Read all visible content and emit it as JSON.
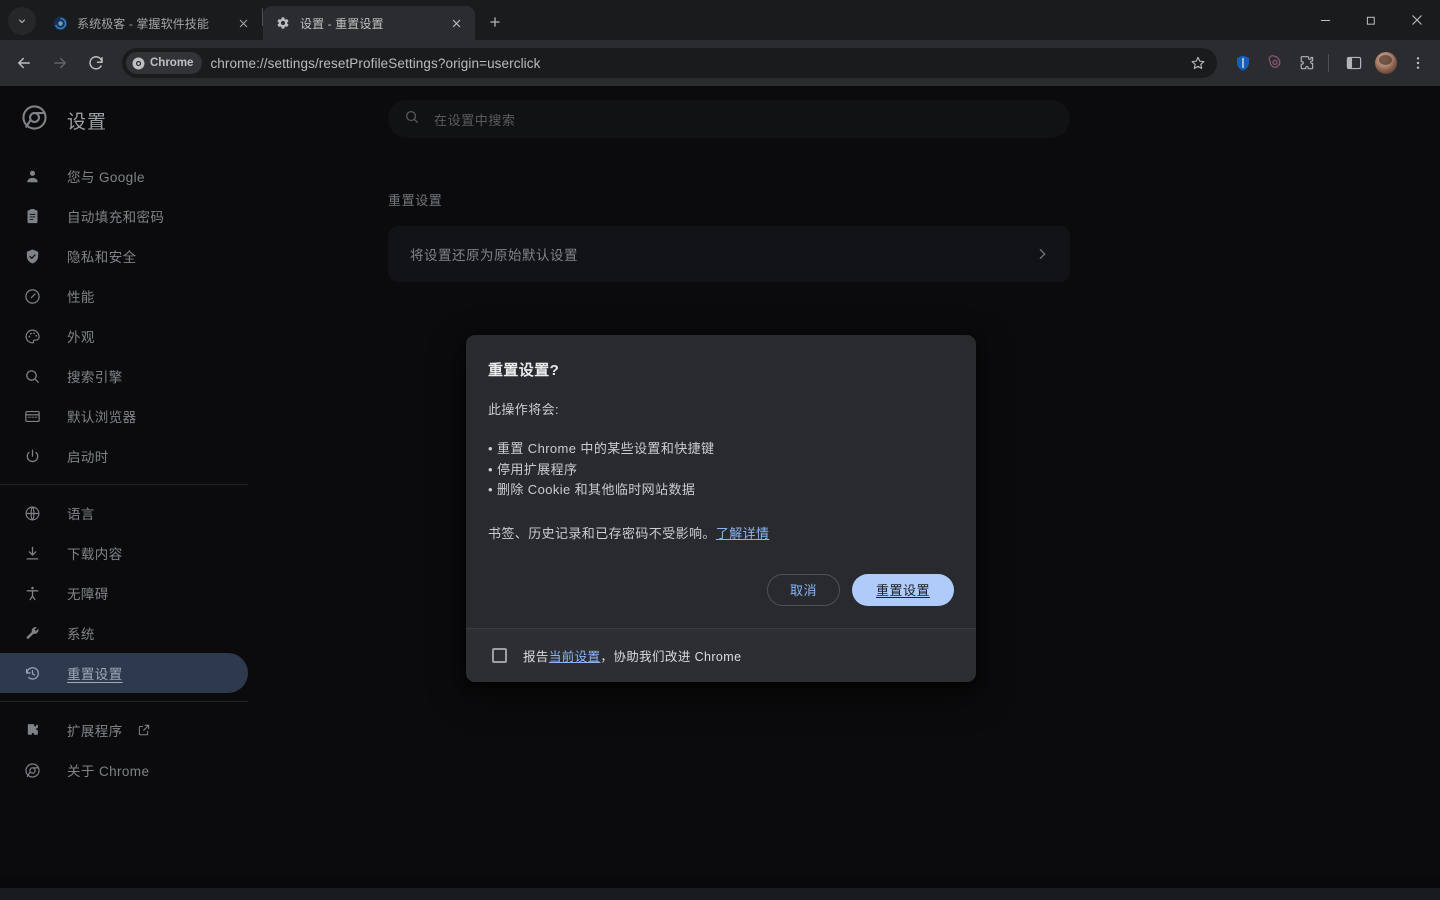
{
  "window": {
    "controls": [
      {
        "name": "minimize-button",
        "glyph": "minimize"
      },
      {
        "name": "maximize-button",
        "glyph": "restore"
      },
      {
        "name": "close-button",
        "glyph": "close"
      }
    ]
  },
  "tabstrip": {
    "tab_search_icon": "chevron-down-icon",
    "new_tab_label": "+",
    "tabs": [
      {
        "title": "系统极客 - 掌握软件技能",
        "favicon": "site-favicon",
        "active": false,
        "close_label": "×"
      },
      {
        "title": "设置 - 重置设置",
        "favicon": "gear-icon",
        "active": true,
        "close_label": "×"
      }
    ]
  },
  "toolbar": {
    "back_icon": "back-arrow-icon",
    "forward_icon": "forward-arrow-icon",
    "reload_icon": "reload-icon",
    "chrome_chip_label": "Chrome",
    "url": "chrome://settings/resetProfileSettings?origin=userclick",
    "bookmark_icon": "star-icon",
    "extensions": [
      {
        "name": "shield-extension-icon",
        "color": "#4285f4"
      },
      {
        "name": "openai-extension-icon",
        "color": "#a8698f"
      },
      {
        "name": "puzzle-extensions-icon",
        "color": "#dadce0"
      }
    ],
    "side_panel_icon": "side-panel-icon",
    "profile_icon": "avatar",
    "menu_icon": "three-dot-menu-icon"
  },
  "settings": {
    "brand_title": "设置",
    "brand_icon": "chrome-logo-icon",
    "search": {
      "placeholder": "在设置中搜索",
      "icon": "search-icon",
      "value": ""
    },
    "sidebar_groups": [
      {
        "items": [
          {
            "label": "您与 Google",
            "icon": "person-icon",
            "selected": false
          },
          {
            "label": "自动填充和密码",
            "icon": "autofill-icon",
            "selected": false
          },
          {
            "label": "隐私和安全",
            "icon": "shield-check-icon",
            "selected": false
          },
          {
            "label": "性能",
            "icon": "speedometer-icon",
            "selected": false
          },
          {
            "label": "外观",
            "icon": "palette-icon",
            "selected": false
          },
          {
            "label": "搜索引擎",
            "icon": "search-icon",
            "selected": false
          },
          {
            "label": "默认浏览器",
            "icon": "browser-window-icon",
            "selected": false
          },
          {
            "label": "启动时",
            "icon": "power-icon",
            "selected": false
          }
        ]
      },
      {
        "items": [
          {
            "label": "语言",
            "icon": "globe-icon",
            "selected": false
          },
          {
            "label": "下载内容",
            "icon": "download-icon",
            "selected": false
          },
          {
            "label": "无障碍",
            "icon": "accessibility-icon",
            "selected": false
          },
          {
            "label": "系统",
            "icon": "wrench-icon",
            "selected": false
          },
          {
            "label": "重置设置",
            "icon": "history-reset-icon",
            "selected": true
          }
        ]
      },
      {
        "items": [
          {
            "label": "扩展程序",
            "icon": "puzzle-icon",
            "selected": false,
            "external": true,
            "external_icon": "open-in-new-icon"
          },
          {
            "label": "关于 Chrome",
            "icon": "chrome-logo-icon",
            "selected": false
          }
        ]
      }
    ],
    "section_title": "重置设置",
    "rows": [
      {
        "label": "将设置还原为原始默认设置",
        "chevron_icon": "chevron-right-icon"
      }
    ]
  },
  "dialog": {
    "title": "重置设置?",
    "lead": "此操作将会:",
    "bullets": [
      "• 重置 Chrome 中的某些设置和快捷键",
      "• 停用扩展程序",
      "• 删除 Cookie 和其他临时网站数据"
    ],
    "note_text": "书签、历史记录和已存密码不受影响。",
    "note_link": "了解详情",
    "cancel_label": "取消",
    "confirm_label": "重置设置",
    "footer": {
      "checkbox_checked": false,
      "text_before": "报告",
      "link": "当前设置",
      "text_after": "，协助我们改进 Chrome"
    }
  },
  "colors": {
    "accent_blue": "#8ab4f8",
    "primary_button": "#aecbfa",
    "selected_nav": "#37465e",
    "page_bg": "#0e0e11",
    "dialog_bg": "#292a2d",
    "toolbar_bg": "#35363a"
  }
}
